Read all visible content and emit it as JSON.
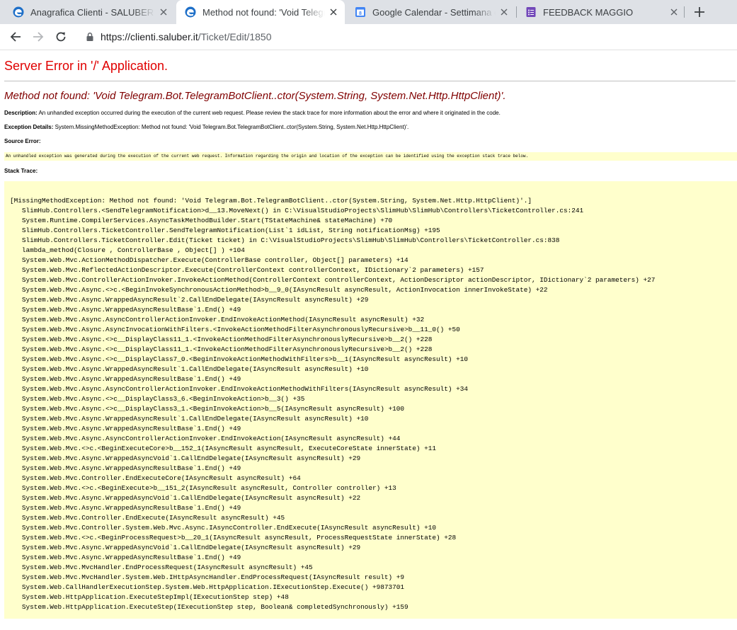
{
  "browser": {
    "tabs": [
      {
        "title": "Anagrafica Clienti - SALUBER Ser",
        "icon": "edge-logo-icon",
        "active": false
      },
      {
        "title": "Method not found: 'Void Telegram",
        "icon": "edge-logo-icon",
        "active": true
      },
      {
        "title": "Google Calendar - Settimana del",
        "icon": "calendar-icon",
        "active": false
      },
      {
        "title": "FEEDBACK MAGGIO",
        "icon": "forms-icon",
        "active": false
      }
    ],
    "url_host": "https://clienti.saluber.it",
    "url_path": "/Ticket/Edit/1850"
  },
  "page": {
    "title": "Server Error in '/' Application.",
    "message": "Method not found: 'Void Telegram.Bot.TelegramBotClient..ctor(System.String, System.Net.Http.HttpClient)'.",
    "description_label": "Description:",
    "description_text": "An unhandled exception occurred during the execution of the current web request. Please review the stack trace for more information about the error and where it originated in the code.",
    "exception_label": "Exception Details:",
    "exception_text": "System.MissingMethodException: Method not found: 'Void Telegram.Bot.TelegramBotClient..ctor(System.String, System.Net.Http.HttpClient)'.",
    "source_label": "Source Error:",
    "source_text": "An unhandled exception was generated during the execution of the current web request. Information regarding the origin and location of the exception can be identified using the exception stack trace below.",
    "stack_label": "Stack Trace:",
    "stack_trace": "[MissingMethodException: Method not found: 'Void Telegram.Bot.TelegramBotClient..ctor(System.String, System.Net.Http.HttpClient)'.]\n   SlimHub.Controllers.<SendTelegramNotification>d__13.MoveNext() in C:\\VisualStudioProjects\\SlimHub\\SlimHub\\Controllers\\TicketController.cs:241\n   System.Runtime.CompilerServices.AsyncTaskMethodBuilder.Start(TStateMachine& stateMachine) +70\n   SlimHub.Controllers.TicketController.SendTelegramNotification(List`1 idList, String notificationMsg) +195\n   SlimHub.Controllers.TicketController.Edit(Ticket ticket) in C:\\VisualStudioProjects\\SlimHub\\SlimHub\\Controllers\\TicketController.cs:838\n   lambda_method(Closure , ControllerBase , Object[] ) +104\n   System.Web.Mvc.ActionMethodDispatcher.Execute(ControllerBase controller, Object[] parameters) +14\n   System.Web.Mvc.ReflectedActionDescriptor.Execute(ControllerContext controllerContext, IDictionary`2 parameters) +157\n   System.Web.Mvc.ControllerActionInvoker.InvokeActionMethod(ControllerContext controllerContext, ActionDescriptor actionDescriptor, IDictionary`2 parameters) +27\n   System.Web.Mvc.Async.<>c.<BeginInvokeSynchronousActionMethod>b__9_0(IAsyncResult asyncResult, ActionInvocation innerInvokeState) +22\n   System.Web.Mvc.Async.WrappedAsyncResult`2.CallEndDelegate(IAsyncResult asyncResult) +29\n   System.Web.Mvc.Async.WrappedAsyncResultBase`1.End() +49\n   System.Web.Mvc.Async.AsyncControllerActionInvoker.EndInvokeActionMethod(IAsyncResult asyncResult) +32\n   System.Web.Mvc.Async.AsyncInvocationWithFilters.<InvokeActionMethodFilterAsynchronouslyRecursive>b__11_0() +50\n   System.Web.Mvc.Async.<>c__DisplayClass11_1.<InvokeActionMethodFilterAsynchronouslyRecursive>b__2() +228\n   System.Web.Mvc.Async.<>c__DisplayClass11_1.<InvokeActionMethodFilterAsynchronouslyRecursive>b__2() +228\n   System.Web.Mvc.Async.<>c__DisplayClass7_0.<BeginInvokeActionMethodWithFilters>b__1(IAsyncResult asyncResult) +10\n   System.Web.Mvc.Async.WrappedAsyncResult`1.CallEndDelegate(IAsyncResult asyncResult) +10\n   System.Web.Mvc.Async.WrappedAsyncResultBase`1.End() +49\n   System.Web.Mvc.Async.AsyncControllerActionInvoker.EndInvokeActionMethodWithFilters(IAsyncResult asyncResult) +34\n   System.Web.Mvc.Async.<>c__DisplayClass3_6.<BeginInvokeAction>b__3() +35\n   System.Web.Mvc.Async.<>c__DisplayClass3_1.<BeginInvokeAction>b__5(IAsyncResult asyncResult) +100\n   System.Web.Mvc.Async.WrappedAsyncResult`1.CallEndDelegate(IAsyncResult asyncResult) +10\n   System.Web.Mvc.Async.WrappedAsyncResultBase`1.End() +49\n   System.Web.Mvc.Async.AsyncControllerActionInvoker.EndInvokeAction(IAsyncResult asyncResult) +44\n   System.Web.Mvc.<>c.<BeginExecuteCore>b__152_1(IAsyncResult asyncResult, ExecuteCoreState innerState) +11\n   System.Web.Mvc.Async.WrappedAsyncVoid`1.CallEndDelegate(IAsyncResult asyncResult) +29\n   System.Web.Mvc.Async.WrappedAsyncResultBase`1.End() +49\n   System.Web.Mvc.Controller.EndExecuteCore(IAsyncResult asyncResult) +64\n   System.Web.Mvc.<>c.<BeginExecute>b__151_2(IAsyncResult asyncResult, Controller controller) +13\n   System.Web.Mvc.Async.WrappedAsyncVoid`1.CallEndDelegate(IAsyncResult asyncResult) +22\n   System.Web.Mvc.Async.WrappedAsyncResultBase`1.End() +49\n   System.Web.Mvc.Controller.EndExecute(IAsyncResult asyncResult) +45\n   System.Web.Mvc.Controller.System.Web.Mvc.Async.IAsyncController.EndExecute(IAsyncResult asyncResult) +10\n   System.Web.Mvc.<>c.<BeginProcessRequest>b__20_1(IAsyncResult asyncResult, ProcessRequestState innerState) +28\n   System.Web.Mvc.Async.WrappedAsyncVoid`1.CallEndDelegate(IAsyncResult asyncResult) +29\n   System.Web.Mvc.Async.WrappedAsyncResultBase`1.End() +49\n   System.Web.Mvc.MvcHandler.EndProcessRequest(IAsyncResult asyncResult) +45\n   System.Web.Mvc.MvcHandler.System.Web.IHttpAsyncHandler.EndProcessRequest(IAsyncResult result) +9\n   System.Web.CallHandlerExecutionStep.System.Web.HttpApplication.IExecutionStep.Execute() +9873701\n   System.Web.HttpApplication.ExecuteStepImpl(IExecutionStep step) +48\n   System.Web.HttpApplication.ExecuteStep(IExecutionStep step, Boolean& completedSynchronously) +159"
  }
}
